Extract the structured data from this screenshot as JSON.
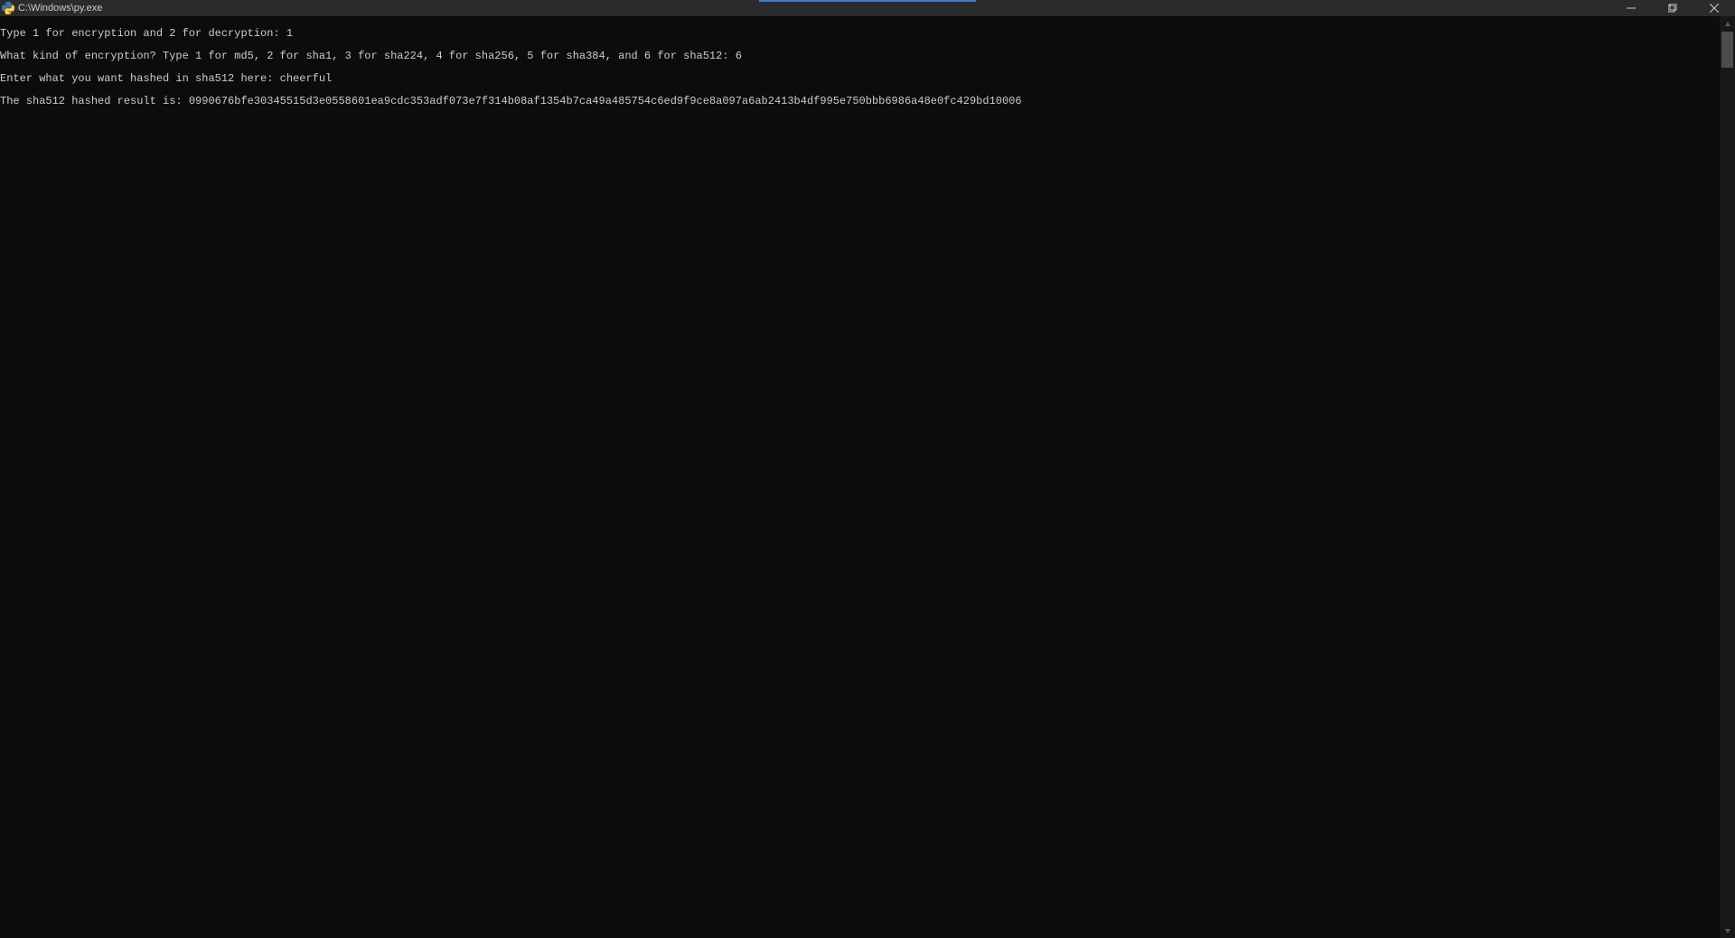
{
  "titlebar": {
    "title": "C:\\Windows\\py.exe"
  },
  "terminal": {
    "lines": [
      "Type 1 for encryption and 2 for decryption: 1",
      "What kind of encryption? Type 1 for md5, 2 for sha1, 3 for sha224, 4 for sha256, 5 for sha384, and 6 for sha512: 6",
      "Enter what you want hashed in sha512 here: cheerful",
      "The sha512 hashed result is: 0990676bfe30345515d3e0558601ea9cdc353adf073e7f314b08af1354b7ca49a485754c6ed9f9ce8a097a6ab2413b4df995e750bbb6986a48e0fc429bd10006"
    ]
  }
}
